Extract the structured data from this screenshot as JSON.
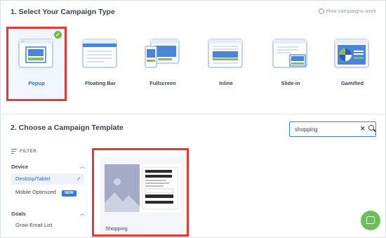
{
  "section1": {
    "title": "1. Select Your Campaign Type",
    "help_link": "How campaigns work"
  },
  "campaign_types": [
    {
      "label": "Popup",
      "selected": true
    },
    {
      "label": "Floating Bar",
      "selected": false
    },
    {
      "label": "Fullscreen",
      "selected": false
    },
    {
      "label": "Inline",
      "selected": false
    },
    {
      "label": "Slide-in",
      "selected": false
    },
    {
      "label": "Gamified",
      "selected": false
    }
  ],
  "section2": {
    "title": "2. Choose a Campaign Template"
  },
  "search": {
    "value": "shopping"
  },
  "filter": {
    "label": "FILTER",
    "device": {
      "title": "Device",
      "options": [
        {
          "label": "Desktop/Tablet",
          "active": true
        },
        {
          "label": "Mobile Optimized",
          "badge": "NEW"
        }
      ]
    },
    "goals": {
      "title": "Goals",
      "options": [
        {
          "label": "Grow Email List"
        }
      ]
    }
  },
  "templates": [
    {
      "name": "Shopping"
    }
  ],
  "colors": {
    "accent": "#2f6fc9",
    "highlight": "#e03b3b",
    "success": "#74b94a"
  }
}
